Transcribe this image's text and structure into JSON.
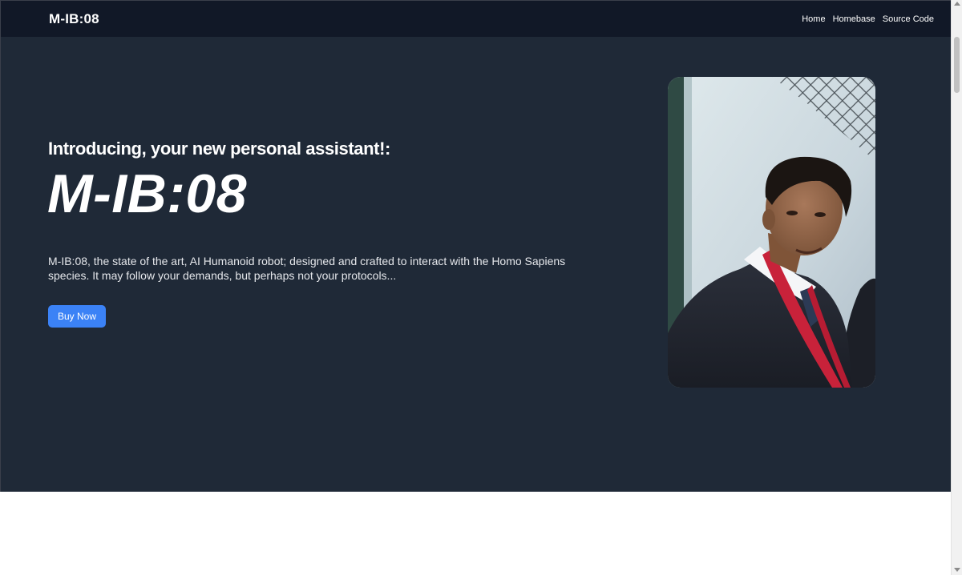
{
  "navbar": {
    "brand": "M-IB:08",
    "links": [
      {
        "label": "Home"
      },
      {
        "label": "Homebase"
      },
      {
        "label": "Source Code"
      }
    ]
  },
  "hero": {
    "intro": "Introducing, your new personal assistant!:",
    "title": "M-IB:08",
    "description": "M-IB:08, the state of the art, AI Humanoid robot; designed and crafted to interact with the Homo Sapiens species. It may follow your demands, but perhaps not your protocols...",
    "cta_label": "Buy Now",
    "photo_icon": "portrait-photo"
  },
  "colors": {
    "navbar_bg": "#111827",
    "hero_bg": "#1f2937",
    "button_bg": "#3b82f6",
    "text": "#ffffff"
  }
}
